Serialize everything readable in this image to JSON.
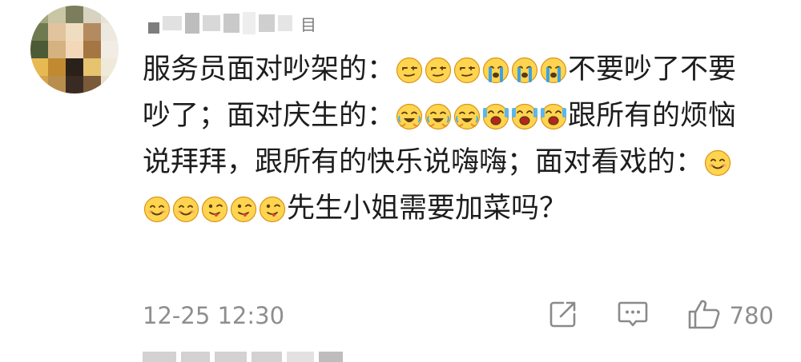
{
  "user": {
    "name_fragment": "目"
  },
  "comment": {
    "segments": [
      {
        "t": "text",
        "v": "服务员面对吵架的："
      },
      {
        "t": "emoji",
        "k": "smirk"
      },
      {
        "t": "emoji",
        "k": "smirk"
      },
      {
        "t": "emoji",
        "k": "smirk"
      },
      {
        "t": "emoji",
        "k": "cry"
      },
      {
        "t": "emoji",
        "k": "cry"
      },
      {
        "t": "emoji",
        "k": "cry"
      },
      {
        "t": "text",
        "v": "不要吵了不要吵了；面对庆生的："
      },
      {
        "t": "emoji",
        "k": "happytears"
      },
      {
        "t": "emoji",
        "k": "happytears"
      },
      {
        "t": "emoji",
        "k": "happytears"
      },
      {
        "t": "emoji",
        "k": "scream"
      },
      {
        "t": "emoji",
        "k": "scream"
      },
      {
        "t": "emoji",
        "k": "scream"
      },
      {
        "t": "text",
        "v": "跟所有的烦恼说拜拜，跟所有的快乐说嗨嗨；面对看戏的："
      },
      {
        "t": "emoji",
        "k": "smile"
      },
      {
        "t": "emoji",
        "k": "smile"
      },
      {
        "t": "emoji",
        "k": "smile"
      },
      {
        "t": "emoji",
        "k": "yum"
      },
      {
        "t": "emoji",
        "k": "yum"
      },
      {
        "t": "emoji",
        "k": "yum"
      },
      {
        "t": "text",
        "v": "先生小姐需要加菜吗？"
      }
    ]
  },
  "meta": {
    "timestamp": "12-25 12:30",
    "like_count": "780"
  },
  "icons": {
    "share": "share-icon",
    "comment": "comment-icon",
    "like": "thumbs-up-icon"
  },
  "colors": {
    "text": "#1d1d1d",
    "meta": "#8e8e8e",
    "emoji_yellow": "#f7c531"
  }
}
